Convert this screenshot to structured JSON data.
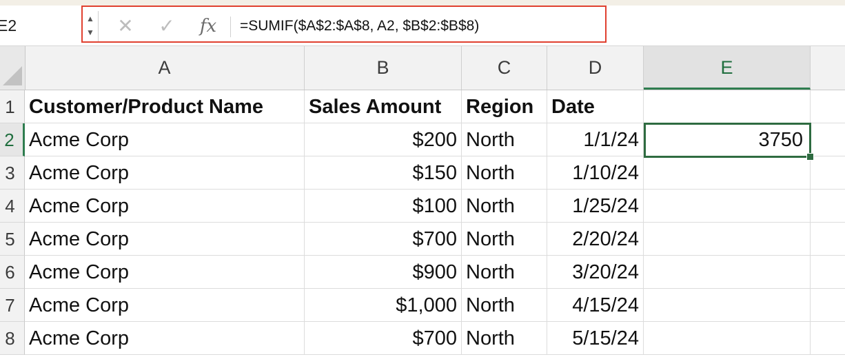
{
  "formula_bar": {
    "name_box": "E2",
    "cancel_icon": "close-icon",
    "confirm_icon": "check-icon",
    "fx_label": "fx",
    "formula": "=SUMIF($A$2:$A$8, A2, $B$2:$B$8)"
  },
  "columns": [
    "A",
    "B",
    "C",
    "D",
    "E"
  ],
  "rows": [
    "1",
    "2",
    "3",
    "4",
    "5",
    "6",
    "7",
    "8"
  ],
  "selected_cell": {
    "column": "E",
    "row": "2"
  },
  "cells": {
    "header": [
      "Customer/Product Name",
      "Sales Amount",
      "Region",
      "Date",
      ""
    ],
    "data": [
      [
        "Acme Corp",
        "$200",
        "North",
        "1/1/24",
        "3750"
      ],
      [
        "Acme Corp",
        "$150",
        "North",
        "1/10/24",
        ""
      ],
      [
        "Acme Corp",
        "$100",
        "North",
        "1/25/24",
        ""
      ],
      [
        "Acme Corp",
        "$700",
        "North",
        "2/20/24",
        ""
      ],
      [
        "Acme Corp",
        "$900",
        "North",
        "3/20/24",
        ""
      ],
      [
        "Acme Corp",
        "$1,000",
        "North",
        "4/15/24",
        ""
      ],
      [
        "Acme Corp",
        "$700",
        "North",
        "5/15/24",
        ""
      ]
    ]
  },
  "colors": {
    "highlight_border": "#e0402f",
    "selection_green": "#2e6b40"
  }
}
